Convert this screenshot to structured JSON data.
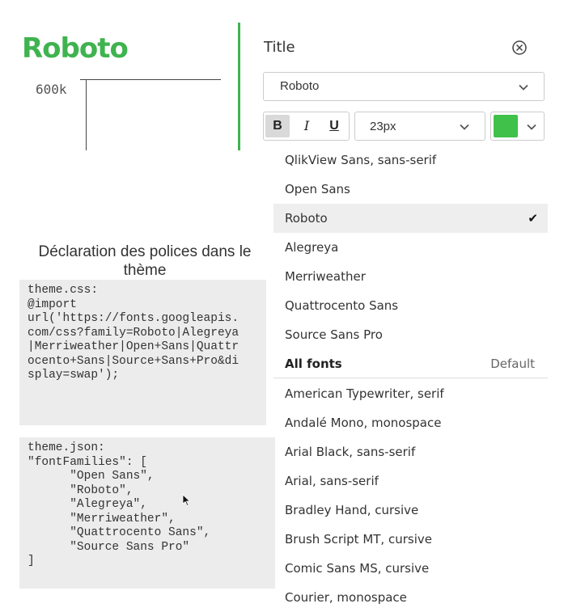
{
  "preview": {
    "title": "Roboto",
    "axis_label": "600k",
    "accent_color": "#3fb34f"
  },
  "panel": {
    "title": "Title",
    "close_icon": "close-circle-icon",
    "font_select": {
      "value": "Roboto",
      "icon": "chevron-down-icon"
    },
    "style_buttons": {
      "bold": "B",
      "italic": "I",
      "underline": "U",
      "bold_active": true
    },
    "font_size": {
      "value": "23px",
      "icon": "chevron-down-icon"
    },
    "color_picker": {
      "color": "#3fc14a",
      "icon": "chevron-down-icon"
    }
  },
  "dropdown": {
    "theme_fonts": [
      {
        "label": "QlikView Sans, sans-serif",
        "selected": false
      },
      {
        "label": "Open Sans",
        "selected": false
      },
      {
        "label": "Roboto",
        "selected": true
      },
      {
        "label": "Alegreya",
        "selected": false
      },
      {
        "label": "Merriweather",
        "selected": false
      },
      {
        "label": "Quattrocento Sans",
        "selected": false
      },
      {
        "label": "Source Sans Pro",
        "selected": false
      }
    ],
    "check_mark": "✔",
    "section_header": {
      "label": "All fonts",
      "right": "Default"
    },
    "all_fonts": [
      {
        "label": "American Typewriter, serif"
      },
      {
        "label": "Andalé Mono, monospace"
      },
      {
        "label": "Arial Black, sans-serif"
      },
      {
        "label": "Arial, sans-serif"
      },
      {
        "label": "Bradley Hand, cursive"
      },
      {
        "label": "Brush Script MT, cursive"
      },
      {
        "label": "Comic Sans MS, cursive"
      },
      {
        "label": "Courier, monospace"
      }
    ]
  },
  "declaration": {
    "title": "Déclaration des polices dans le thème",
    "css_code": "theme.css:\n@import\nurl('https://fonts.googleapis.\ncom/css?family=Roboto|Alegreya\n|Merriweather|Open+Sans|Quattr\nocento+Sans|Source+Sans+Pro&di\nsplay=swap');",
    "json_code": "theme.json:\n\"fontFamilies\": [\n      \"Open Sans\",\n      \"Roboto\",\n      \"Alegreya\",\n      \"Merriweather\",\n      \"Quattrocento Sans\",\n      \"Source Sans Pro\"\n]",
    "cursor_icon": "mouse-pointer-icon"
  }
}
